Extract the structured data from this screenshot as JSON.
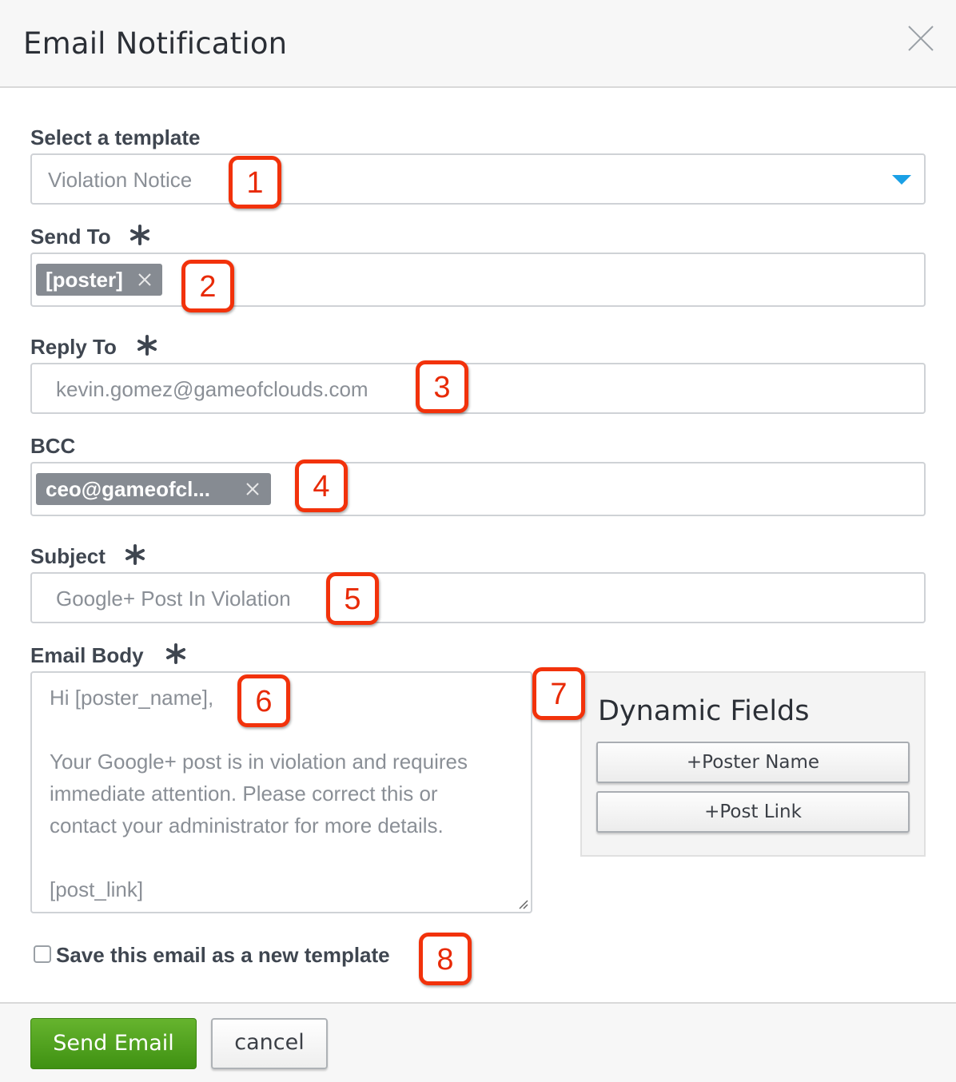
{
  "dialog": {
    "title": "Email Notification",
    "close_icon": "close-icon"
  },
  "form": {
    "template": {
      "label": "Select a template",
      "value": "Violation Notice",
      "dropdown_icon": "caret-down-icon",
      "accent": "#1aa0e6"
    },
    "send_to": {
      "label": "Send To",
      "required_icon": "asterisk-icon",
      "chips": [
        "[poster]"
      ]
    },
    "reply_to": {
      "label": "Reply To",
      "required_icon": "asterisk-icon",
      "value": "kevin.gomez@gameofclouds.com"
    },
    "bcc": {
      "label": "BCC",
      "chips": [
        "ceo@gameofcl..."
      ]
    },
    "subject": {
      "label": "Subject",
      "required_icon": "asterisk-icon",
      "value": "Google+ Post In Violation"
    },
    "email_body": {
      "label": "Email Body",
      "required_icon": "asterisk-icon",
      "lines": [
        "Hi [poster_name],",
        "",
        "Your Google+ post is in violation and requires",
        "immediate attention. Please correct this or",
        "contact your administrator for more details.",
        "",
        "[post_link]"
      ]
    },
    "dynamic_fields": {
      "title": "Dynamic Fields",
      "buttons": [
        "+Poster Name",
        "+Post Link"
      ]
    },
    "save_template": {
      "label": "Save this email as a new template",
      "checked": false
    }
  },
  "footer": {
    "send_label": "Send Email",
    "send_color": "#4ca21c",
    "cancel_label": "cancel"
  },
  "callouts": {
    "color": "#f2320b",
    "labels": [
      "1",
      "2",
      "3",
      "4",
      "5",
      "6",
      "7",
      "8"
    ]
  }
}
